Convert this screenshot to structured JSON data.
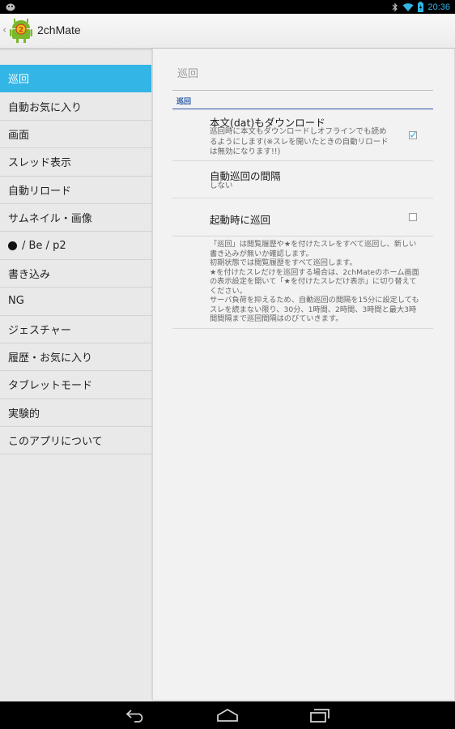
{
  "status_bar": {
    "time": "20:36",
    "left_icon": "android-notification-icon",
    "right_icons": [
      "bluetooth-icon",
      "wifi-icon",
      "battery-icon"
    ]
  },
  "action_bar": {
    "title": "2chMate",
    "app_icon": "app-icon"
  },
  "sidebar": {
    "selected_index": 0,
    "items": [
      {
        "label": "巡回"
      },
      {
        "label": "自動お気に入り"
      },
      {
        "label": "画面"
      },
      {
        "label": "スレッド表示"
      },
      {
        "label": "自動リロード"
      },
      {
        "label": "サムネイル・画像"
      },
      {
        "label": "/ Be / p2",
        "bullet": true
      },
      {
        "label": "書き込み"
      },
      {
        "label": "NG"
      },
      {
        "label": "ジェスチャー"
      },
      {
        "label": "履歴・お気に入り"
      },
      {
        "label": "タブレットモード"
      },
      {
        "label": "実験的"
      },
      {
        "label": "このアプリについて"
      }
    ]
  },
  "panel": {
    "page_title": "巡回",
    "section_header": "巡回",
    "prefs": [
      {
        "title": "本文(dat)もダウンロード",
        "summary": "巡回時に本文もダウンロードしオフラインでも読めるようにします(※スレを開いたときの自動リロードは無効になります!!)",
        "checked": true
      },
      {
        "title": "自動巡回の間隔",
        "summary": "しない"
      },
      {
        "title": "起動時に巡回",
        "checked": false
      }
    ],
    "help_lines": [
      "「巡回」は閲覧履歴や★を付けたスレをすべて巡回し、新しい書き込みが無いか確認します。",
      "初期状態では閲覧履歴をすべて巡回します。",
      "★を付けたスレだけを巡回する場合は、2chMateのホーム画面の表示設定を開いて「★を付けたスレだけ表示」に切り替えてください。",
      "サーバ負荷を抑えるため、自動巡回の間隔を15分に設定してもスレを読まない限り、30分、1時間、2時間、3時間と最大3時間間隔まで巡回間隔はのびていきます。"
    ]
  },
  "nav_bar": {
    "buttons": [
      "back-icon",
      "home-icon",
      "recent-apps-icon"
    ]
  },
  "colors": {
    "accent": "#33b5e5",
    "section_header": "#2b57a7"
  }
}
